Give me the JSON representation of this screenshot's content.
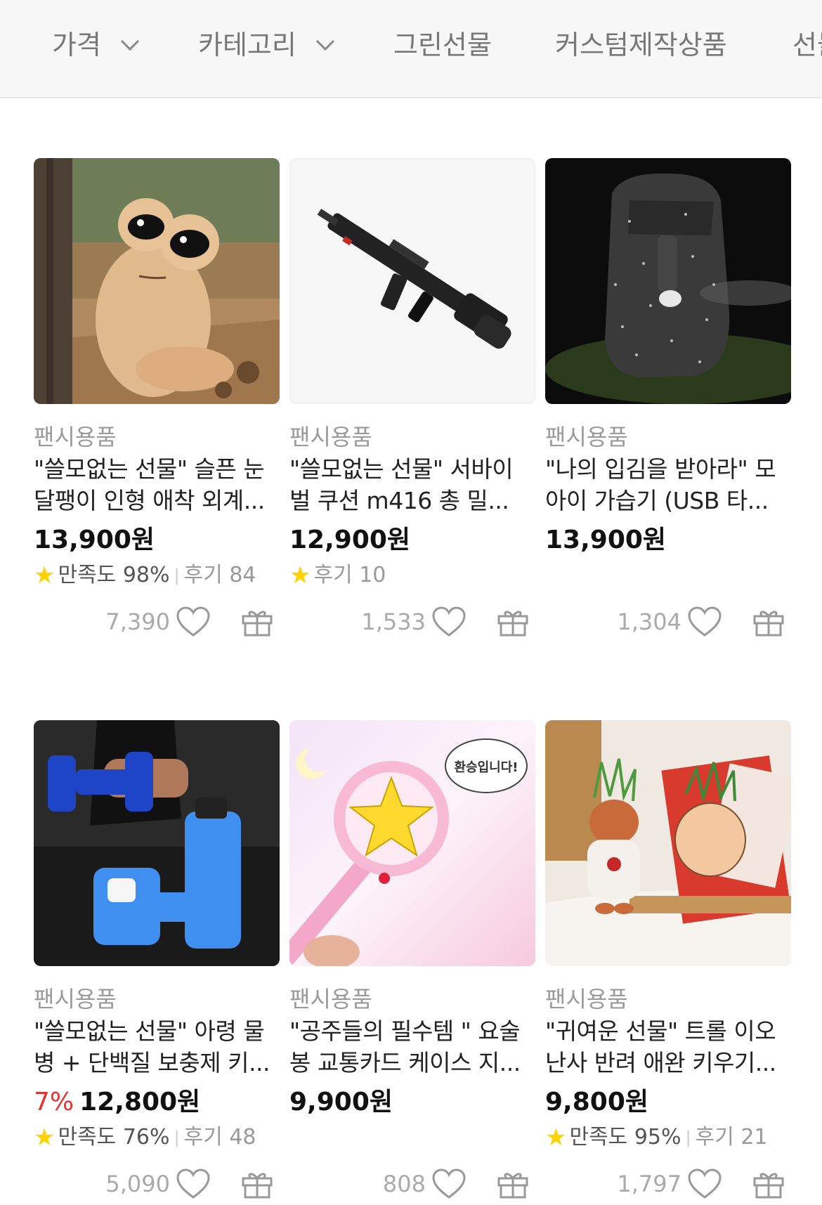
{
  "filters": [
    {
      "label": "가격",
      "dropdown": true
    },
    {
      "label": "카테고리",
      "dropdown": true
    },
    {
      "label": "그린선물",
      "dropdown": false
    },
    {
      "label": "커스텀제작상품",
      "dropdown": false
    },
    {
      "label": "선물",
      "dropdown": false
    }
  ],
  "products": [
    {
      "category": "팬시용품",
      "title_line1": "\"쓸모없는 선물\" 슬픈 눈",
      "title_line2": "달팽이 인형 애착 외계...",
      "discount": "",
      "price": "13,900",
      "unit": "원",
      "satisfaction": "만족도 98%",
      "reviews": "후기 84",
      "likes": "7,390",
      "image": "snail-plush"
    },
    {
      "category": "팬시용품",
      "title_line1": "\"쓸모없는 선물\" 서바이",
      "title_line2": "벌 쿠션 m416 총 밀...",
      "discount": "",
      "price": "12,900",
      "unit": "원",
      "satisfaction": "",
      "reviews": "후기 10",
      "likes": "1,533",
      "image": "rifle-cushion"
    },
    {
      "category": "팬시용품",
      "title_line1": "\"나의 입김을 받아라\" 모",
      "title_line2": "아이 가습기 (USB 타...",
      "discount": "",
      "price": "13,900",
      "unit": "원",
      "satisfaction": "",
      "reviews": "",
      "likes": "1,304",
      "image": "moai-humidifier"
    },
    {
      "category": "팬시용품",
      "title_line1": "\"쓸모없는 선물\" 아령 물",
      "title_line2": "병 + 단백질 보충제 키...",
      "discount": "7%",
      "price": "12,800",
      "unit": "원",
      "satisfaction": "만족도 76%",
      "reviews": "후기 48",
      "likes": "5,090",
      "image": "dumbbell-bottle"
    },
    {
      "category": "팬시용품",
      "title_line1": "\"공주들의 필수템 \" 요술",
      "title_line2": "봉 교통카드 케이스 지...",
      "discount": "",
      "price": "9,900",
      "unit": "원",
      "satisfaction": "",
      "reviews": "",
      "likes": "808",
      "image": "magic-wand",
      "image_text": "환승입니다!"
    },
    {
      "category": "팬시용품",
      "title_line1": "\"귀여운 선물\" 트롤 이오",
      "title_line2": "난사 반려 애완 키우기...",
      "discount": "",
      "price": "9,800",
      "unit": "원",
      "satisfaction": "만족도 95%",
      "reviews": "후기 21",
      "likes": "1,797",
      "image": "troll-plant"
    }
  ],
  "colors": {
    "accent_red": "#e8322f",
    "star": "#ffd200",
    "muted": "#9a9a9a"
  }
}
